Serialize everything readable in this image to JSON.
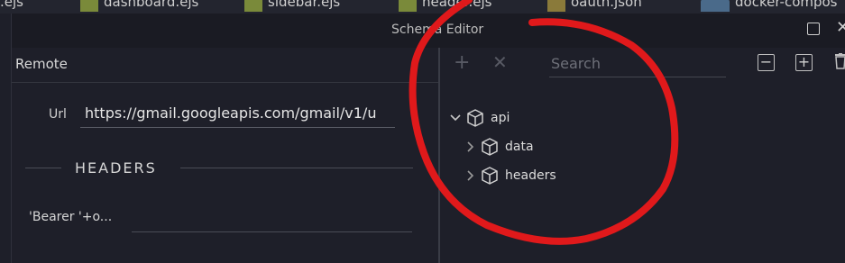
{
  "tabs": [
    {
      "label": ".ejs",
      "icon": "ejs-file-icon"
    },
    {
      "label": "dashboard.ejs",
      "icon": "ejs-file-icon"
    },
    {
      "label": "sidebar.ejs",
      "icon": "ejs-file-icon"
    },
    {
      "label": "header.ejs",
      "icon": "ejs-file-icon"
    },
    {
      "label": "oauth.json",
      "icon": "json-file-icon"
    },
    {
      "label": "docker-compos",
      "icon": "docker-icon"
    }
  ],
  "window": {
    "title": "Schema Editor"
  },
  "left": {
    "heading": "Remote",
    "url_label": "Url",
    "url_value": "https://gmail.googleapis.com/gmail/v1/u",
    "headers_title": "HEADERS",
    "header_row_label": "'Bearer '+o..."
  },
  "right": {
    "search_placeholder": "Search",
    "tree": [
      {
        "label": "api",
        "expanded": true,
        "depth": 0
      },
      {
        "label": "data",
        "expanded": false,
        "depth": 1
      },
      {
        "label": "headers",
        "expanded": false,
        "depth": 1
      }
    ]
  },
  "colors": {
    "background": "#1e1f29",
    "annotation": "#e0191b"
  }
}
